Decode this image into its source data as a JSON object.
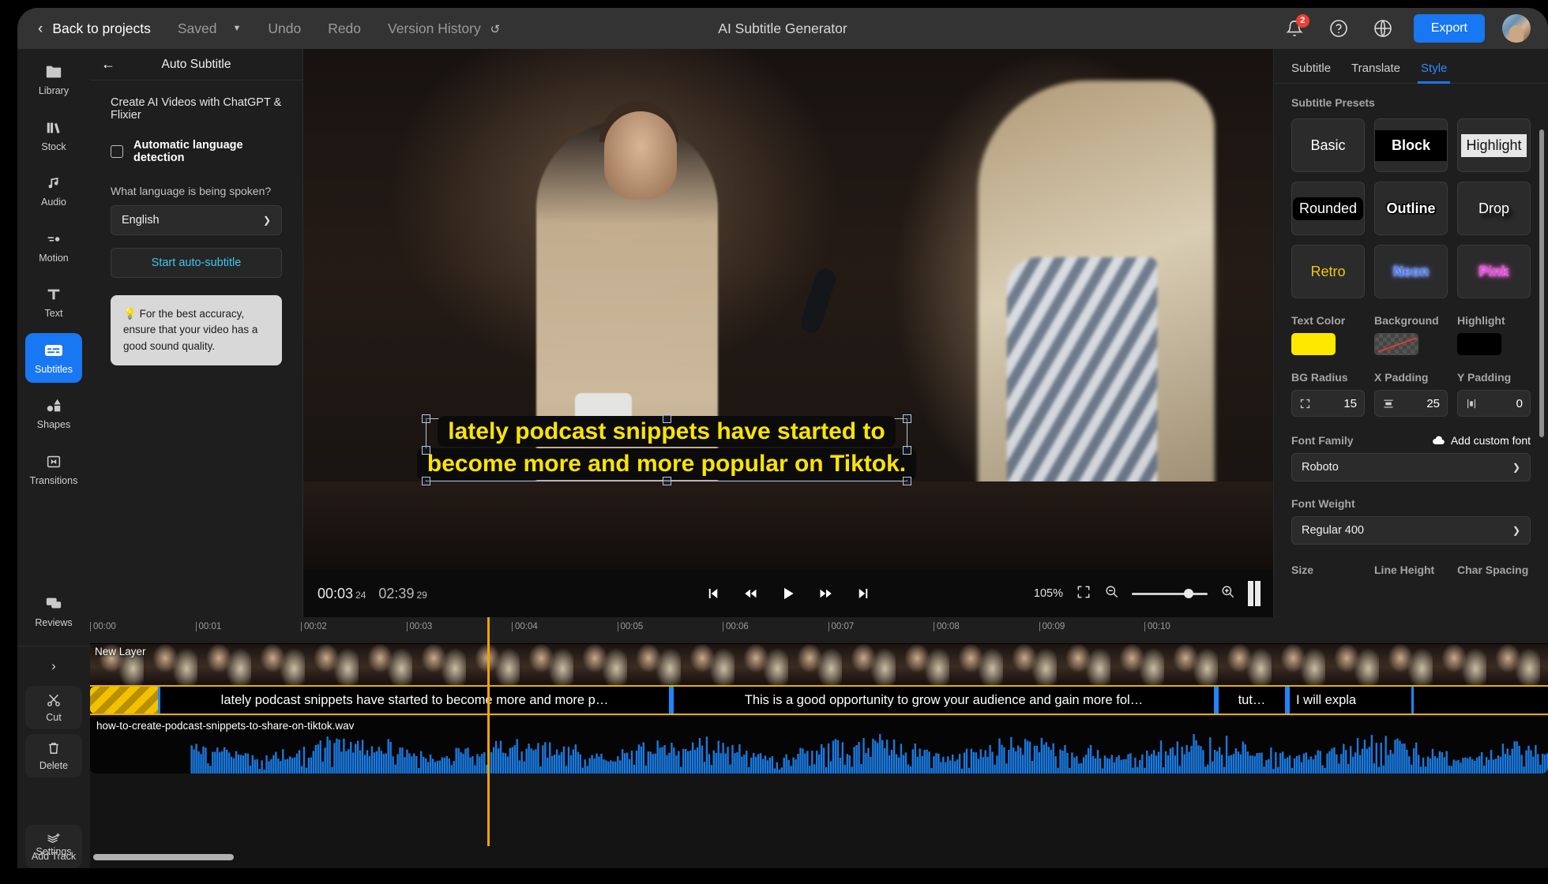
{
  "header": {
    "back_label": "Back to projects",
    "saved_label": "Saved",
    "undo_label": "Undo",
    "redo_label": "Redo",
    "version_history_label": "Version History",
    "title": "AI Subtitle Generator",
    "notification_count": "2",
    "export_label": "Export",
    "accent_color": "#1877f2",
    "badge_color": "#ef3e33"
  },
  "rail": {
    "items": [
      {
        "label": "Library",
        "icon": "folder-icon",
        "active": false
      },
      {
        "label": "Stock",
        "icon": "books-icon",
        "active": false
      },
      {
        "label": "Audio",
        "icon": "music-note-icon",
        "active": false
      },
      {
        "label": "Motion",
        "icon": "motion-icon",
        "active": false
      },
      {
        "label": "Text",
        "icon": "text-t-icon",
        "active": false
      },
      {
        "label": "Subtitles",
        "icon": "subtitles-icon",
        "active": true
      },
      {
        "label": "Shapes",
        "icon": "shapes-icon",
        "active": false
      },
      {
        "label": "Transitions",
        "icon": "transitions-icon",
        "active": false
      },
      {
        "label": "Reviews",
        "icon": "speech-bubbles-icon",
        "active": false
      }
    ],
    "tools": [
      {
        "label": "Cut",
        "icon": "scissors-icon"
      },
      {
        "label": "Delete",
        "icon": "trash-icon"
      },
      {
        "label": "Add Track",
        "icon": "add-track-icon"
      }
    ],
    "settings_label": "Settings"
  },
  "panel": {
    "title": "Auto Subtitle",
    "lead": "Create AI Videos with ChatGPT & Flixier",
    "checkbox_label": "Automatic language detection",
    "checkbox_checked": false,
    "language_question": "What language is being spoken?",
    "language_value": "English",
    "start_button": "Start auto-subtitle",
    "tip": "For the best accuracy, ensure that your video has a good sound quality.",
    "tip_icon": "💡"
  },
  "player": {
    "subtitle_line_1": "lately podcast snippets have started to",
    "subtitle_line_2": "become more and more popular on Tiktok.",
    "subtitle_text_color": "#fbe400",
    "current_time": "00:03",
    "current_frames": "24",
    "duration": "02:39",
    "duration_frames": "29",
    "zoom_level": "105%"
  },
  "right_panel": {
    "tabs": [
      {
        "label": "Subtitle",
        "active": false
      },
      {
        "label": "Translate",
        "active": false
      },
      {
        "label": "Style",
        "active": true
      }
    ],
    "presets_label": "Subtitle Presets",
    "presets": [
      {
        "label": "Basic",
        "style": "basic"
      },
      {
        "label": "Block",
        "style": "block"
      },
      {
        "label": "Highlight",
        "style": "highlight"
      },
      {
        "label": "Rounded",
        "style": "rounded"
      },
      {
        "label": "Outline",
        "style": "outline"
      },
      {
        "label": "Drop",
        "style": "drop"
      },
      {
        "label": "Retro",
        "style": "retro"
      },
      {
        "label": "Neon",
        "style": "neon"
      },
      {
        "label": "Pink",
        "style": "pink"
      }
    ],
    "text_color_label": "Text Color",
    "text_color_value": "#FFE800",
    "background_label": "Background",
    "background_value": "none",
    "highlight_label": "Highlight",
    "highlight_value": "#000000",
    "bg_radius_label": "BG Radius",
    "bg_radius_value": "15",
    "x_padding_label": "X Padding",
    "x_padding_value": "25",
    "y_padding_label": "Y Padding",
    "y_padding_value": "0",
    "font_family_label": "Font Family",
    "add_custom_font_label": "Add custom font",
    "font_family_value": "Roboto",
    "font_weight_label": "Font Weight",
    "font_weight_value": "Regular 400",
    "size_label": "Size",
    "line_height_label": "Line Height",
    "char_spacing_label": "Char Spacing"
  },
  "timeline": {
    "ruler_ticks": [
      "00:00",
      "00:01",
      "00:02",
      "00:03",
      "00:04",
      "00:05",
      "00:06",
      "00:07",
      "00:08",
      "00:09",
      "00:10"
    ],
    "layer_label": "New Layer",
    "audio_file": "how-to-create-podcast-snippets-to-share-on-tiktok.wav",
    "subtitle_clips": [
      {
        "text": "lately podcast snippets have started to become more and more p…"
      },
      {
        "text": "This is a good opportunity to grow your audience and gain more fol…"
      },
      {
        "text": "tut…"
      },
      {
        "text": "I will expla"
      }
    ]
  }
}
